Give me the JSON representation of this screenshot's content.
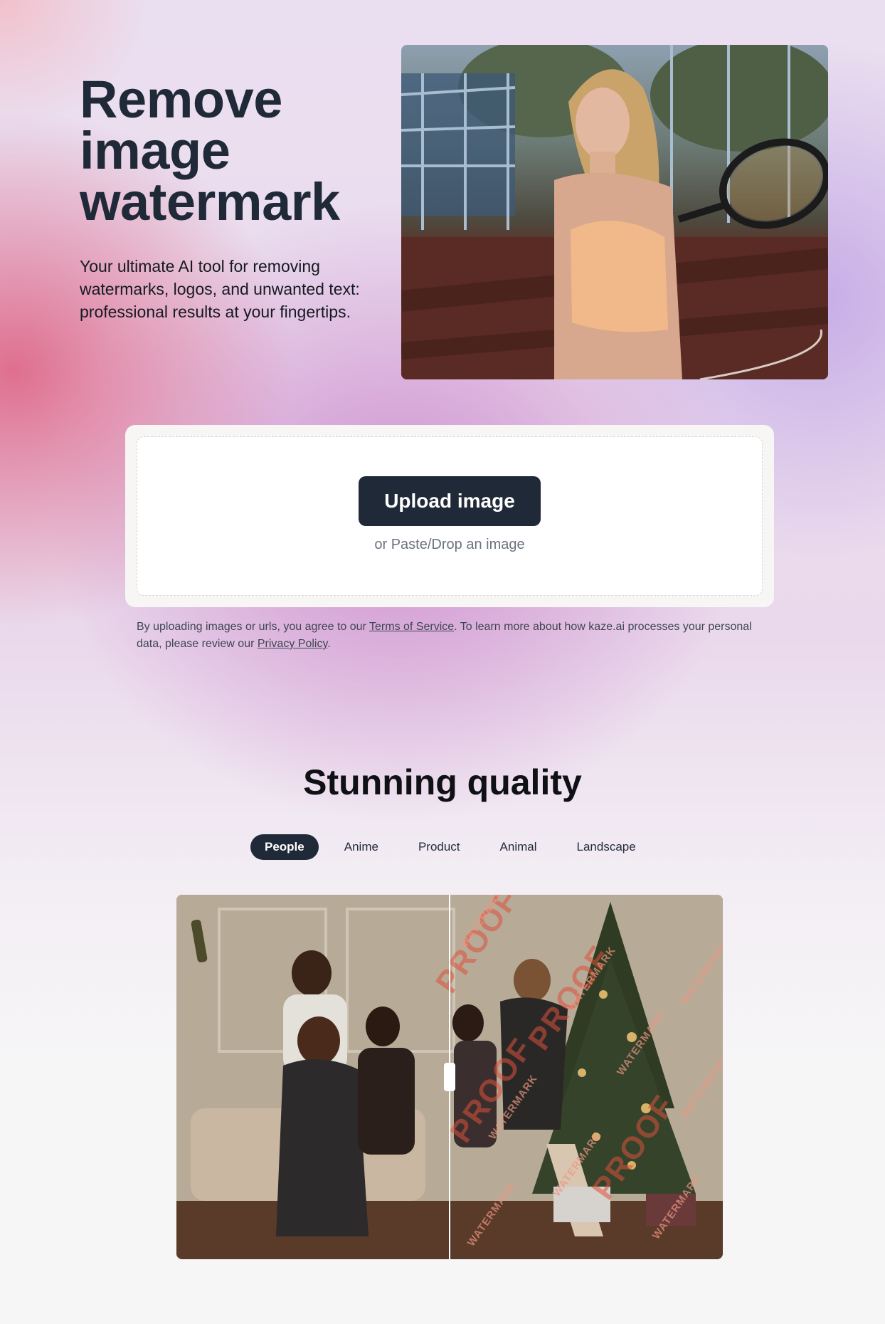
{
  "hero": {
    "title": "Remove image watermark",
    "subtitle": "Your ultimate AI tool for removing watermarks, logos, and unwanted text: professional results at your fingertips."
  },
  "upload": {
    "button_label": "Upload image",
    "hint": "or Paste/Drop an image"
  },
  "legal": {
    "prefix": "By uploading images or urls, you agree to our ",
    "terms_link": "Terms of Service",
    "middle": ". To learn more about how kaze.ai processes your personal data, please review our ",
    "privacy_link": "Privacy Policy",
    "suffix": "."
  },
  "quality": {
    "title": "Stunning quality",
    "tabs": [
      "People",
      "Anime",
      "Product",
      "Animal",
      "Landscape"
    ],
    "active_tab": "People"
  },
  "compare": {
    "watermark_text_large": "PROOF",
    "watermark_text_small": "WATERMARK",
    "slider_position": 0.5
  },
  "colors": {
    "primary": "#1f2937",
    "watermark": "#dc503c"
  },
  "icons": [
    "slider-handle-icon"
  ]
}
